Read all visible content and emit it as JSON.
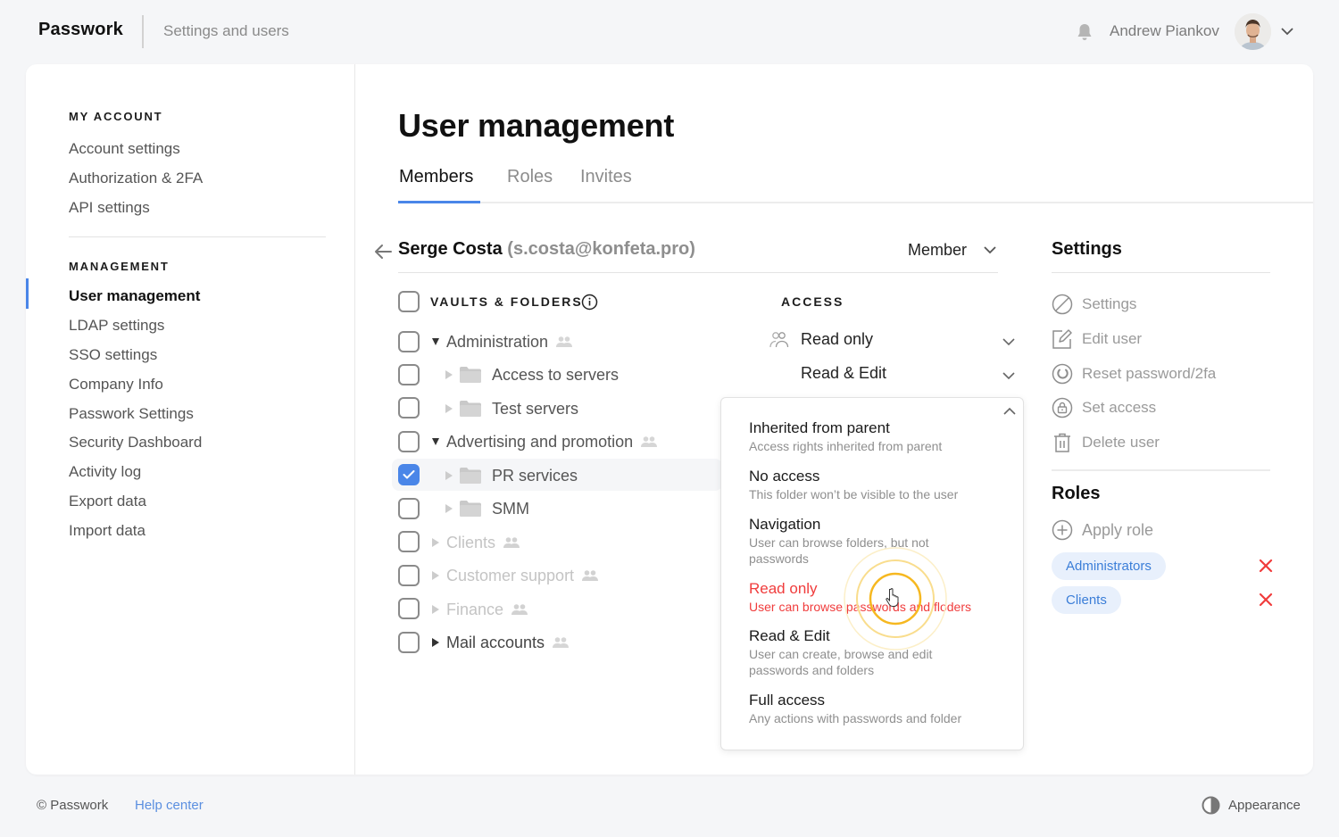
{
  "header": {
    "brand": "Passwork",
    "section": "Settings and users",
    "user_name": "Andrew Piankov",
    "icons": {
      "notifications": "bell-icon",
      "menu": "chevron-down-icon"
    }
  },
  "sidebar": {
    "groups": [
      {
        "heading": "MY ACCOUNT",
        "items": [
          {
            "label": "Account settings"
          },
          {
            "label": "Authorization & 2FA"
          },
          {
            "label": "API settings"
          }
        ]
      },
      {
        "heading": "MANAGEMENT",
        "items": [
          {
            "label": "User management",
            "active": true
          },
          {
            "label": "LDAP settings"
          },
          {
            "label": "SSO settings"
          },
          {
            "label": "Company Info"
          },
          {
            "label": "Passwork Settings"
          },
          {
            "label": "Security Dashboard"
          },
          {
            "label": "Activity log"
          },
          {
            "label": "Export data"
          },
          {
            "label": "Import data"
          }
        ]
      }
    ]
  },
  "main": {
    "title": "User management",
    "tabs": [
      {
        "label": "Members",
        "active": true
      },
      {
        "label": "Roles"
      },
      {
        "label": "Invites"
      }
    ],
    "user": {
      "name": "Serge Costa",
      "email": "(s.costa@konfeta.pro)",
      "role": "Member"
    },
    "columns": {
      "vaults": "VAULTS & FOLDERS",
      "access": "ACCESS"
    },
    "tree": [
      {
        "label": "Administration",
        "level": 0,
        "type": "vault",
        "expanded": true,
        "checked": false,
        "style": "normal",
        "access": "Read only",
        "access_icon": "users-icon"
      },
      {
        "label": "Access to servers",
        "level": 1,
        "type": "folder",
        "checked": false,
        "style": "normal",
        "access": "Read & Edit"
      },
      {
        "label": "Test servers",
        "level": 1,
        "type": "folder",
        "checked": false,
        "style": "normal"
      },
      {
        "label": "Advertising and promotion",
        "level": 0,
        "type": "vault",
        "expanded": true,
        "checked": false,
        "style": "normal"
      },
      {
        "label": "PR services",
        "level": 1,
        "type": "folder",
        "checked": true,
        "style": "normal"
      },
      {
        "label": "SMM",
        "level": 1,
        "type": "folder",
        "checked": false,
        "style": "normal"
      },
      {
        "label": "Clients",
        "level": 0,
        "type": "vault",
        "expanded": false,
        "checked": false,
        "style": "dim"
      },
      {
        "label": "Customer support",
        "level": 0,
        "type": "vault",
        "expanded": false,
        "checked": false,
        "style": "dim"
      },
      {
        "label": "Finance",
        "level": 0,
        "type": "vault",
        "expanded": false,
        "checked": false,
        "style": "dim"
      },
      {
        "label": "Mail accounts",
        "level": 0,
        "type": "vault",
        "expanded": false,
        "checked": false,
        "style": "dark"
      }
    ],
    "access_dropdown": {
      "selected": "Read only",
      "options": [
        {
          "title": "Inherited from parent",
          "desc": "Access rights inherited from parent"
        },
        {
          "title": "No access",
          "desc": "This folder won’t be visible to the user"
        },
        {
          "title": "Navigation",
          "desc": "User can browse folders, but not passwords"
        },
        {
          "title": "Read only",
          "desc": "User can browse passwords and floders",
          "selected": true
        },
        {
          "title": "Read & Edit",
          "desc": "User can create, browse and edit passwords and folders"
        },
        {
          "title": "Full access",
          "desc": "Any actions with passwords and folder"
        }
      ],
      "selected_color": "#f03c3c"
    }
  },
  "panel": {
    "settings_title": "Settings",
    "actions": [
      {
        "label": "Settings",
        "icon": "disabled-icon"
      },
      {
        "label": "Edit user",
        "icon": "edit-icon"
      },
      {
        "label": "Reset password/2fa",
        "icon": "reset-icon"
      },
      {
        "label": "Set access",
        "icon": "lock-icon"
      },
      {
        "label": "Delete user",
        "icon": "trash-icon"
      }
    ],
    "roles_title": "Roles",
    "apply_role": "Apply role",
    "roles": [
      {
        "label": "Administrators"
      },
      {
        "label": "Clients"
      }
    ]
  },
  "footer": {
    "copyright": "© Passwork",
    "help": "Help center",
    "appearance": "Appearance"
  },
  "colors": {
    "accent": "#4a86e8",
    "danger": "#f03c3c",
    "chip_bg": "#e8f0fc",
    "chip_text": "#3b7ed8",
    "cursor_ring": "#f6b820"
  }
}
